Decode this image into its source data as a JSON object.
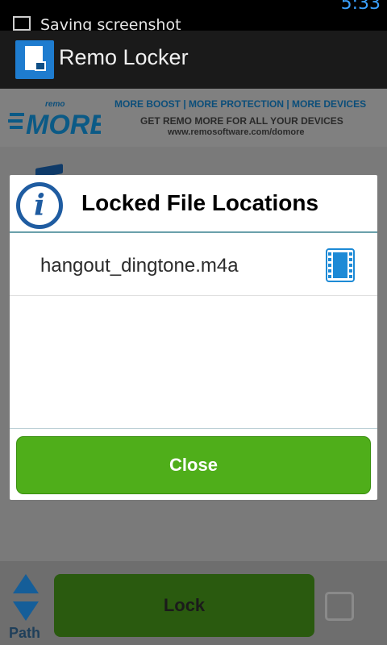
{
  "status_bar": {
    "notification_text": "Saving screenshot",
    "time": "5:33"
  },
  "app_bar": {
    "title": "Remo Locker",
    "logo_icon": "remo-locker-logo"
  },
  "banner": {
    "brand_small": "remo",
    "brand_big": "MORE",
    "line1": "MORE BOOST | MORE PROTECTION | MORE DEVICES",
    "line2": "GET REMO MORE FOR ALL YOUR DEVICES",
    "line3": "www.remosoftware.com/domore"
  },
  "dialog": {
    "title": "Locked File Locations",
    "title_icon": "info-icon",
    "files": [
      {
        "name": "hangout_dingtone.m4a",
        "icon": "film-icon"
      }
    ],
    "close_label": "Close"
  },
  "bottom_bar": {
    "path_label": "Path",
    "lock_label": "Lock"
  },
  "colors": {
    "accent_green": "#4fae1a",
    "info_blue": "#1f5ca1",
    "overlay_gray": "#7a7a7a"
  }
}
